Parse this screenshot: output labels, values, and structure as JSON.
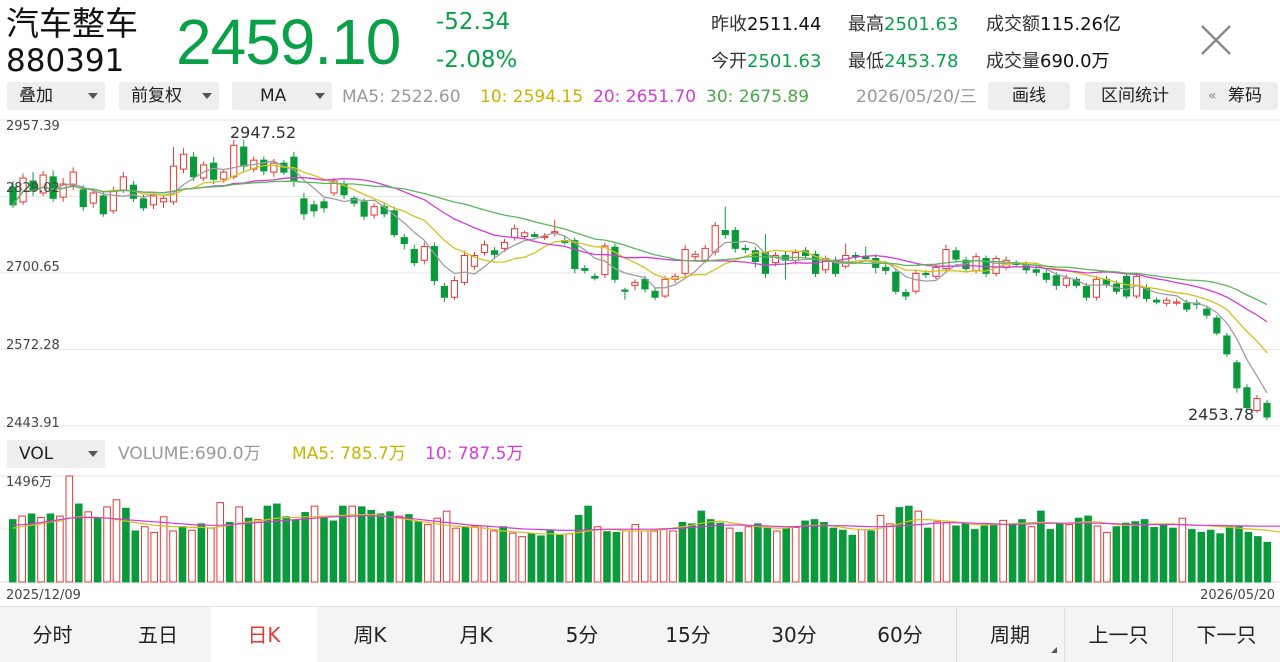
{
  "header": {
    "name": "汽车整车",
    "code": "880391",
    "price": "2459.10",
    "change": "-52.34",
    "change_pct": "-2.08%",
    "stats": {
      "prev_close_label": "昨收",
      "prev_close": "2511.44",
      "high_label": "最高",
      "high": "2501.63",
      "amount_label": "成交额",
      "amount": "115.26亿",
      "open_label": "今开",
      "open": "2501.63",
      "low_label": "最低",
      "low": "2453.78",
      "volume_label": "成交量",
      "volume": "690.0万"
    }
  },
  "toolbar": {
    "overlay_label": "叠加",
    "adjust_label": "前复权",
    "indicator_label": "MA",
    "ma5": "MA5: 2522.60",
    "ma10": "10: 2594.15",
    "ma20": "20: 2651.70",
    "ma30": "30: 2675.89",
    "date": "2026/05/20/三",
    "draw_label": "画线",
    "range_stat_label": "区间统计",
    "chips_label": "筹码"
  },
  "price_chart": {
    "y_labels": [
      "2957.39",
      "2829.02",
      "2700.65",
      "2572.28",
      "2443.91"
    ],
    "max_label": "2947.52",
    "min_label": "2453.78"
  },
  "volume_bar": {
    "selector_label": "VOL",
    "volume_text": "VOLUME:690.0万",
    "ma5_text": "MA5: 785.7万",
    "ma10_text": "10: 787.5万",
    "top_label": "1496万",
    "start_date": "2025/12/09",
    "end_date": "2026/05/20"
  },
  "tabs": {
    "items": [
      "分时",
      "五日",
      "日K",
      "周K",
      "月K",
      "5分",
      "15分",
      "30分",
      "60分"
    ],
    "active_index": 2,
    "period_label": "周期",
    "prev_label": "上一只",
    "next_label": "下一只"
  },
  "colors": {
    "up": "#e53935",
    "down": "#0a9a3c",
    "ma5": "#9e9e9e",
    "ma10": "#d4c21e",
    "ma20": "#d63ad6",
    "ma30": "#5cb85c",
    "price_green": "#0aa04a"
  },
  "chart_data": {
    "type": "candlestick",
    "y_range": [
      2443.91,
      2957.39
    ],
    "candles": [
      {
        "o": 2845,
        "c": 2815,
        "h": 2855,
        "l": 2810
      },
      {
        "o": 2820,
        "c": 2860,
        "h": 2868,
        "l": 2815
      },
      {
        "o": 2855,
        "c": 2840,
        "h": 2870,
        "l": 2830
      },
      {
        "o": 2835,
        "c": 2865,
        "h": 2872,
        "l": 2830
      },
      {
        "o": 2862,
        "c": 2826,
        "h": 2873,
        "l": 2820
      },
      {
        "o": 2828,
        "c": 2850,
        "h": 2860,
        "l": 2820
      },
      {
        "o": 2848,
        "c": 2870,
        "h": 2878,
        "l": 2840
      },
      {
        "o": 2840,
        "c": 2812,
        "h": 2848,
        "l": 2805
      },
      {
        "o": 2818,
        "c": 2835,
        "h": 2842,
        "l": 2810
      },
      {
        "o": 2830,
        "c": 2800,
        "h": 2838,
        "l": 2795
      },
      {
        "o": 2805,
        "c": 2838,
        "h": 2845,
        "l": 2800
      },
      {
        "o": 2840,
        "c": 2862,
        "h": 2870,
        "l": 2835
      },
      {
        "o": 2848,
        "c": 2826,
        "h": 2855,
        "l": 2820
      },
      {
        "o": 2825,
        "c": 2810,
        "h": 2832,
        "l": 2805
      },
      {
        "o": 2815,
        "c": 2830,
        "h": 2836,
        "l": 2808
      },
      {
        "o": 2820,
        "c": 2826,
        "h": 2832,
        "l": 2810
      },
      {
        "o": 2820,
        "c": 2880,
        "h": 2912,
        "l": 2815
      },
      {
        "o": 2875,
        "c": 2900,
        "h": 2910,
        "l": 2868
      },
      {
        "o": 2895,
        "c": 2862,
        "h": 2904,
        "l": 2855
      },
      {
        "o": 2860,
        "c": 2882,
        "h": 2888,
        "l": 2855
      },
      {
        "o": 2885,
        "c": 2858,
        "h": 2895,
        "l": 2850
      },
      {
        "o": 2858,
        "c": 2870,
        "h": 2875,
        "l": 2852
      },
      {
        "o": 2862,
        "c": 2915,
        "h": 2924,
        "l": 2858
      },
      {
        "o": 2912,
        "c": 2880,
        "h": 2924,
        "l": 2870
      },
      {
        "o": 2875,
        "c": 2890,
        "h": 2896,
        "l": 2870
      },
      {
        "o": 2890,
        "c": 2872,
        "h": 2896,
        "l": 2865
      },
      {
        "o": 2870,
        "c": 2885,
        "h": 2892,
        "l": 2862
      },
      {
        "o": 2885,
        "c": 2870,
        "h": 2890,
        "l": 2865
      },
      {
        "o": 2895,
        "c": 2855,
        "h": 2904,
        "l": 2845
      },
      {
        "o": 2825,
        "c": 2800,
        "h": 2835,
        "l": 2790
      },
      {
        "o": 2815,
        "c": 2805,
        "h": 2822,
        "l": 2795
      },
      {
        "o": 2820,
        "c": 2810,
        "h": 2826,
        "l": 2802
      },
      {
        "o": 2835,
        "c": 2855,
        "h": 2860,
        "l": 2830
      },
      {
        "o": 2850,
        "c": 2832,
        "h": 2856,
        "l": 2825
      },
      {
        "o": 2826,
        "c": 2818,
        "h": 2830,
        "l": 2812
      },
      {
        "o": 2820,
        "c": 2796,
        "h": 2826,
        "l": 2790
      },
      {
        "o": 2798,
        "c": 2812,
        "h": 2818,
        "l": 2792
      },
      {
        "o": 2812,
        "c": 2800,
        "h": 2818,
        "l": 2794
      },
      {
        "o": 2805,
        "c": 2765,
        "h": 2812,
        "l": 2760
      },
      {
        "o": 2760,
        "c": 2750,
        "h": 2766,
        "l": 2740
      },
      {
        "o": 2740,
        "c": 2718,
        "h": 2748,
        "l": 2712
      },
      {
        "o": 2722,
        "c": 2745,
        "h": 2752,
        "l": 2715
      },
      {
        "o": 2745,
        "c": 2688,
        "h": 2752,
        "l": 2680
      },
      {
        "o": 2678,
        "c": 2660,
        "h": 2684,
        "l": 2652
      },
      {
        "o": 2660,
        "c": 2688,
        "h": 2695,
        "l": 2655
      },
      {
        "o": 2685,
        "c": 2730,
        "h": 2738,
        "l": 2680
      },
      {
        "o": 2712,
        "c": 2730,
        "h": 2736,
        "l": 2706
      },
      {
        "o": 2735,
        "c": 2748,
        "h": 2755,
        "l": 2730
      },
      {
        "o": 2738,
        "c": 2732,
        "h": 2744,
        "l": 2726
      },
      {
        "o": 2742,
        "c": 2752,
        "h": 2758,
        "l": 2736
      },
      {
        "o": 2760,
        "c": 2775,
        "h": 2782,
        "l": 2755
      },
      {
        "o": 2762,
        "c": 2768,
        "h": 2772,
        "l": 2758
      },
      {
        "o": 2765,
        "c": 2762,
        "h": 2770,
        "l": 2760
      },
      {
        "o": 2760,
        "c": 2762,
        "h": 2768,
        "l": 2756
      },
      {
        "o": 2768,
        "c": 2770,
        "h": 2790,
        "l": 2762
      },
      {
        "o": 2755,
        "c": 2752,
        "h": 2762,
        "l": 2748
      },
      {
        "o": 2755,
        "c": 2708,
        "h": 2760,
        "l": 2700
      },
      {
        "o": 2708,
        "c": 2705,
        "h": 2714,
        "l": 2700
      },
      {
        "o": 2695,
        "c": 2692,
        "h": 2700,
        "l": 2688
      },
      {
        "o": 2698,
        "c": 2746,
        "h": 2752,
        "l": 2692
      },
      {
        "o": 2744,
        "c": 2690,
        "h": 2750,
        "l": 2684
      },
      {
        "o": 2672,
        "c": 2670,
        "h": 2676,
        "l": 2656
      },
      {
        "o": 2680,
        "c": 2685,
        "h": 2690,
        "l": 2672
      },
      {
        "o": 2690,
        "c": 2674,
        "h": 2696,
        "l": 2668
      },
      {
        "o": 2670,
        "c": 2660,
        "h": 2676,
        "l": 2655
      },
      {
        "o": 2662,
        "c": 2690,
        "h": 2696,
        "l": 2658
      },
      {
        "o": 2690,
        "c": 2695,
        "h": 2700,
        "l": 2684
      },
      {
        "o": 2700,
        "c": 2740,
        "h": 2748,
        "l": 2695
      },
      {
        "o": 2728,
        "c": 2732,
        "h": 2738,
        "l": 2722
      },
      {
        "o": 2722,
        "c": 2742,
        "h": 2748,
        "l": 2718
      },
      {
        "o": 2736,
        "c": 2780,
        "h": 2786,
        "l": 2730
      },
      {
        "o": 2772,
        "c": 2765,
        "h": 2812,
        "l": 2758
      },
      {
        "o": 2772,
        "c": 2742,
        "h": 2778,
        "l": 2735
      },
      {
        "o": 2742,
        "c": 2740,
        "h": 2748,
        "l": 2734
      },
      {
        "o": 2738,
        "c": 2720,
        "h": 2744,
        "l": 2710
      },
      {
        "o": 2735,
        "c": 2700,
        "h": 2766,
        "l": 2692
      },
      {
        "o": 2718,
        "c": 2730,
        "h": 2736,
        "l": 2712
      },
      {
        "o": 2730,
        "c": 2722,
        "h": 2738,
        "l": 2690
      },
      {
        "o": 2722,
        "c": 2735,
        "h": 2740,
        "l": 2715
      },
      {
        "o": 2738,
        "c": 2730,
        "h": 2744,
        "l": 2725
      },
      {
        "o": 2732,
        "c": 2700,
        "h": 2738,
        "l": 2694
      },
      {
        "o": 2706,
        "c": 2725,
        "h": 2730,
        "l": 2700
      },
      {
        "o": 2722,
        "c": 2700,
        "h": 2728,
        "l": 2694
      },
      {
        "o": 2712,
        "c": 2730,
        "h": 2750,
        "l": 2708
      },
      {
        "o": 2730,
        "c": 2728,
        "h": 2736,
        "l": 2722
      },
      {
        "o": 2728,
        "c": 2725,
        "h": 2745,
        "l": 2720
      },
      {
        "o": 2725,
        "c": 2710,
        "h": 2732,
        "l": 2700
      },
      {
        "o": 2710,
        "c": 2705,
        "h": 2716,
        "l": 2698
      },
      {
        "o": 2702,
        "c": 2670,
        "h": 2708,
        "l": 2665
      },
      {
        "o": 2668,
        "c": 2662,
        "h": 2674,
        "l": 2655
      },
      {
        "o": 2670,
        "c": 2700,
        "h": 2706,
        "l": 2665
      },
      {
        "o": 2700,
        "c": 2698,
        "h": 2706,
        "l": 2692
      },
      {
        "o": 2695,
        "c": 2710,
        "h": 2716,
        "l": 2690
      },
      {
        "o": 2708,
        "c": 2740,
        "h": 2748,
        "l": 2703
      },
      {
        "o": 2738,
        "c": 2724,
        "h": 2744,
        "l": 2718
      },
      {
        "o": 2722,
        "c": 2708,
        "h": 2728,
        "l": 2702
      },
      {
        "o": 2705,
        "c": 2728,
        "h": 2734,
        "l": 2700
      },
      {
        "o": 2725,
        "c": 2700,
        "h": 2730,
        "l": 2694
      },
      {
        "o": 2700,
        "c": 2725,
        "h": 2730,
        "l": 2695
      },
      {
        "o": 2710,
        "c": 2722,
        "h": 2728,
        "l": 2705
      },
      {
        "o": 2718,
        "c": 2715,
        "h": 2722,
        "l": 2710
      },
      {
        "o": 2714,
        "c": 2706,
        "h": 2720,
        "l": 2700
      },
      {
        "o": 2706,
        "c": 2702,
        "h": 2712,
        "l": 2696
      },
      {
        "o": 2700,
        "c": 2690,
        "h": 2706,
        "l": 2684
      },
      {
        "o": 2696,
        "c": 2680,
        "h": 2702,
        "l": 2672
      },
      {
        "o": 2680,
        "c": 2692,
        "h": 2698,
        "l": 2675
      },
      {
        "o": 2690,
        "c": 2680,
        "h": 2694,
        "l": 2675
      },
      {
        "o": 2678,
        "c": 2660,
        "h": 2684,
        "l": 2654
      },
      {
        "o": 2660,
        "c": 2690,
        "h": 2696,
        "l": 2655
      },
      {
        "o": 2690,
        "c": 2682,
        "h": 2696,
        "l": 2676
      },
      {
        "o": 2682,
        "c": 2670,
        "h": 2688,
        "l": 2665
      },
      {
        "o": 2695,
        "c": 2662,
        "h": 2700,
        "l": 2658
      },
      {
        "o": 2662,
        "c": 2695,
        "h": 2700,
        "l": 2658
      },
      {
        "o": 2675,
        "c": 2658,
        "h": 2682,
        "l": 2652
      },
      {
        "o": 2655,
        "c": 2652,
        "h": 2660,
        "l": 2648
      },
      {
        "o": 2650,
        "c": 2655,
        "h": 2660,
        "l": 2645
      },
      {
        "o": 2650,
        "c": 2652,
        "h": 2658,
        "l": 2646
      },
      {
        "o": 2650,
        "c": 2640,
        "h": 2656,
        "l": 2635
      },
      {
        "o": 2650,
        "c": 2648,
        "h": 2656,
        "l": 2640
      },
      {
        "o": 2640,
        "c": 2630,
        "h": 2646,
        "l": 2624
      },
      {
        "o": 2625,
        "c": 2600,
        "h": 2630,
        "l": 2596
      },
      {
        "o": 2595,
        "c": 2565,
        "h": 2600,
        "l": 2560
      },
      {
        "o": 2550,
        "c": 2508,
        "h": 2555,
        "l": 2500
      },
      {
        "o": 2508,
        "c": 2475,
        "h": 2514,
        "l": 2470
      },
      {
        "o": 2470,
        "c": 2490,
        "h": 2496,
        "l": 2466
      },
      {
        "o": 2482,
        "c": 2459,
        "h": 2488,
        "l": 2453
      }
    ],
    "volumes": [
      880,
      930,
      960,
      910,
      960,
      930,
      1496,
      1100,
      990,
      900,
      1060,
      1160,
      1040,
      720,
      780,
      700,
      920,
      720,
      780,
      730,
      820,
      760,
      1120,
      840,
      1060,
      900,
      880,
      1070,
      1100,
      920,
      870,
      980,
      1070,
      900,
      860,
      1070,
      1070,
      1060,
      1010,
      960,
      990,
      930,
      950,
      850,
      810,
      900,
      1000,
      760,
      770,
      790,
      790,
      720,
      780,
      690,
      640,
      680,
      650,
      720,
      660,
      680,
      940,
      1070,
      780,
      710,
      700,
      720,
      810,
      720,
      720,
      750,
      720,
      840,
      820,
      1000,
      880,
      830,
      760,
      700,
      780,
      820,
      760,
      720,
      760,
      770,
      860,
      880,
      840,
      760,
      730,
      660,
      740,
      720,
      940,
      820,
      1050,
      1070,
      1000,
      760,
      850,
      840,
      790,
      820,
      740,
      790,
      820,
      870,
      820,
      880,
      780,
      1000,
      740,
      820,
      810,
      900,
      930,
      790,
      700,
      780,
      830,
      850,
      880,
      770,
      800,
      760,
      900,
      740,
      700,
      730,
      680,
      780,
      790,
      700,
      640,
      560
    ],
    "volume_ma5": [
      760,
      780,
      800,
      820,
      850,
      860,
      900,
      920,
      920,
      910,
      900,
      880,
      860,
      840,
      820,
      800,
      790,
      780,
      780,
      770,
      770,
      760,
      780,
      800,
      830,
      850,
      860,
      880,
      900,
      910,
      910,
      920,
      920,
      930,
      930,
      940,
      950,
      950,
      950,
      940,
      920,
      900,
      880,
      860,
      840,
      820,
      800,
      790,
      780,
      770,
      760,
      740,
      720,
      710,
      700,
      690,
      680,
      680,
      670,
      680,
      700,
      720,
      740,
      740,
      740,
      720,
      720,
      720,
      730,
      740,
      760,
      780,
      800,
      830,
      850,
      860,
      840,
      820,
      800,
      780,
      770,
      760,
      760,
      780,
      790,
      800,
      800,
      790,
      770,
      750,
      740,
      740,
      760,
      790,
      820,
      860,
      880,
      880,
      870,
      860,
      850,
      830,
      810,
      810,
      810,
      810,
      820,
      830,
      840,
      840,
      840,
      830,
      830,
      840,
      850,
      850,
      830,
      810,
      800,
      800,
      810,
      820,
      820,
      820,
      810,
      800,
      800,
      790,
      780,
      770,
      760,
      750,
      740,
      730,
      710,
      700,
      690
    ],
    "volume_ma10": [
      800,
      810,
      820,
      840,
      860,
      880,
      900,
      910,
      910,
      910,
      900,
      890,
      880,
      870,
      860,
      850,
      840,
      830,
      820,
      810,
      800,
      800,
      800,
      810,
      820,
      830,
      840,
      850,
      860,
      870,
      880,
      890,
      900,
      910,
      920,
      925,
      930,
      935,
      935,
      930,
      920,
      910,
      900,
      885,
      870,
      855,
      840,
      825,
      810,
      800,
      790,
      780,
      770,
      760,
      750,
      745,
      740,
      735,
      730,
      730,
      730,
      735,
      740,
      745,
      745,
      745,
      745,
      745,
      745,
      750,
      755,
      760,
      770,
      780,
      790,
      800,
      805,
      805,
      800,
      795,
      790,
      785,
      780,
      780,
      785,
      790,
      795,
      795,
      795,
      790,
      785,
      780,
      780,
      785,
      790,
      800,
      810,
      820,
      830,
      835,
      835,
      835,
      830,
      825,
      820,
      815,
      815,
      815,
      820,
      825,
      830,
      830,
      830,
      830,
      830,
      830,
      825,
      820,
      815,
      810,
      810,
      810,
      810,
      810,
      810,
      805,
      800,
      800,
      798,
      795,
      792,
      790,
      788,
      787,
      787,
      787,
      787
    ],
    "ma_marks": {
      "ma5": 2522.6,
      "ma10": 2594.15,
      "ma20": 2651.7,
      "ma30": 2675.89
    }
  }
}
